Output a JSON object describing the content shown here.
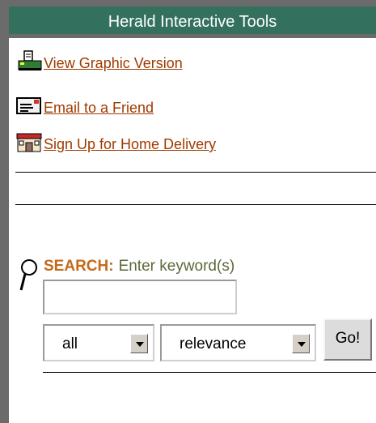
{
  "header": {
    "title": "Herald Interactive Tools"
  },
  "tools": [
    {
      "label": "View Graphic Version",
      "icon": "printer-icon"
    },
    {
      "label": "Email to a Friend",
      "icon": "email-icon"
    },
    {
      "label": "Sign Up for Home Delivery",
      "icon": "home-delivery-icon"
    }
  ],
  "search": {
    "label": "SEARCH:",
    "hint": "Enter keyword(s)",
    "input_value": "",
    "scope_selected": "all",
    "sort_selected": "relevance",
    "go_label": "Go!"
  },
  "colors": {
    "header_bg": "#33705d",
    "link": "#a03a00",
    "search_label": "#c46a1a",
    "hint": "#5b6a3b"
  }
}
